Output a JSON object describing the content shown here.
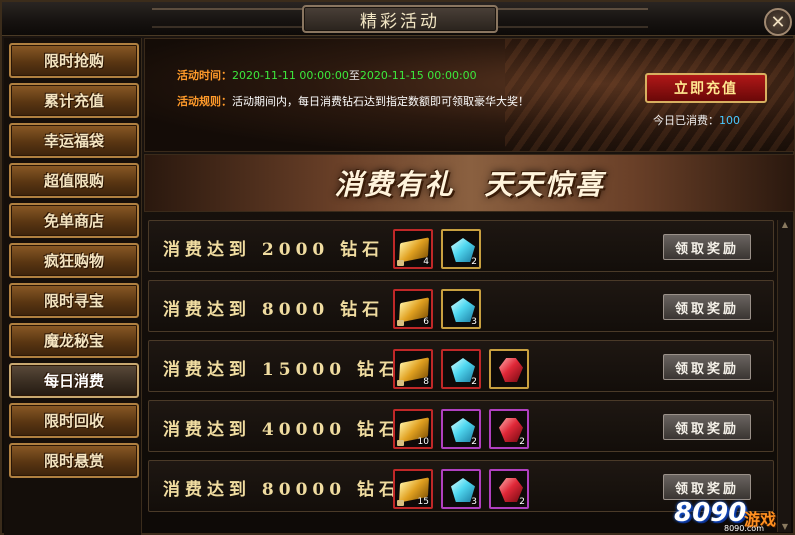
{
  "window": {
    "title": "精彩活动",
    "close_label": "✕"
  },
  "sidebar": {
    "items": [
      {
        "label": "限时抢购"
      },
      {
        "label": "累计充值"
      },
      {
        "label": "幸运福袋"
      },
      {
        "label": "超值限购"
      },
      {
        "label": "免单商店"
      },
      {
        "label": "疯狂购物"
      },
      {
        "label": "限时寻宝"
      },
      {
        "label": "魔龙秘宝"
      },
      {
        "label": "每日消费",
        "active": true
      },
      {
        "label": "限时回收"
      },
      {
        "label": "限时悬赏"
      }
    ]
  },
  "info": {
    "time_label": "活动时间：",
    "time_start": "2020-11-11 00:00:00",
    "time_sep": "至",
    "time_end": "2020-11-15 00:00:00",
    "rule_label": "活动规则：",
    "rule_text": "活动期间内，每日消费钻石达到指定数额即可领取豪华大奖！",
    "recharge_button": "立即充值",
    "consumed_label": "今日已消费：",
    "consumed_value": "100"
  },
  "banner": {
    "text": "消费有礼　天天惊喜"
  },
  "rewards": [
    {
      "label": "消费达到 2000 钻石",
      "items": [
        {
          "icon": "gold-bar-icon",
          "count": "4"
        },
        {
          "icon": "blue-gem-icon",
          "count": "2"
        }
      ],
      "claim": "领取奖励"
    },
    {
      "label": "消费达到 8000 钻石",
      "items": [
        {
          "icon": "gold-bar-icon",
          "count": "6"
        },
        {
          "icon": "blue-gem-icon",
          "count": "3"
        }
      ],
      "claim": "领取奖励"
    },
    {
      "label": "消费达到 15000 钻石",
      "items": [
        {
          "icon": "gold-bar-icon",
          "count": "8"
        },
        {
          "icon": "blue-gem-icon",
          "count": "2"
        },
        {
          "icon": "red-gem-icon",
          "count": ""
        }
      ],
      "claim": "领取奖励"
    },
    {
      "label": "消费达到 40000 钻石",
      "items": [
        {
          "icon": "gold-bar-icon",
          "count": "10"
        },
        {
          "icon": "blue-gem-icon",
          "count": "2"
        },
        {
          "icon": "red-gem-icon",
          "count": "2"
        }
      ],
      "claim": "领取奖励"
    },
    {
      "label": "消费达到 80000 钻石",
      "items": [
        {
          "icon": "gold-bar-icon",
          "count": "15"
        },
        {
          "icon": "blue-gem-icon",
          "count": "3"
        },
        {
          "icon": "red-gem-icon",
          "count": "2"
        }
      ],
      "claim": "领取奖励"
    }
  ],
  "watermark": {
    "brand": "8090",
    "game": "游戏",
    "domain": "8090.com"
  },
  "colors": {
    "accent_orange": "#ff9a2a",
    "time_green": "#3ce83c",
    "consumed_blue": "#4ac8ff",
    "recharge_red": "#b01818"
  }
}
